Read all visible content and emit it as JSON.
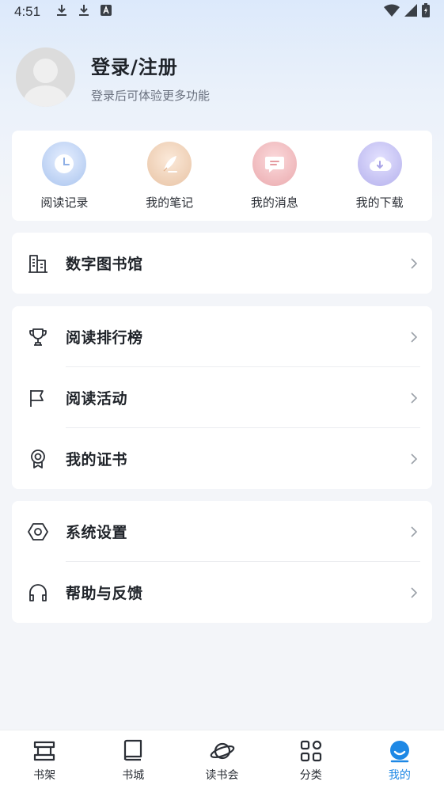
{
  "status_bar": {
    "time": "4:51",
    "left_icons": [
      "download-icon",
      "download-icon",
      "text-a-icon"
    ],
    "right_icons": [
      "wifi-icon",
      "cellular-signal-icon",
      "battery-icon"
    ]
  },
  "profile": {
    "title": "登录/注册",
    "subtitle": "登录后可体验更多功能"
  },
  "quick_actions": [
    {
      "label": "阅读记录",
      "icon": "clock-icon",
      "color": "#a9c4ee"
    },
    {
      "label": "我的笔记",
      "icon": "feather-icon",
      "color": "#e8c3a4"
    },
    {
      "label": "我的消息",
      "icon": "message-icon",
      "color": "#eaa9ad"
    },
    {
      "label": "我的下载",
      "icon": "cloud-download-icon",
      "color": "#b4b0ec"
    }
  ],
  "menu": {
    "library": {
      "label": "数字图书馆"
    },
    "ranking": {
      "label": "阅读排行榜"
    },
    "activity": {
      "label": "阅读活动"
    },
    "certificate": {
      "label": "我的证书"
    },
    "settings": {
      "label": "系统设置"
    },
    "help": {
      "label": "帮助与反馈"
    }
  },
  "bottom_nav": [
    {
      "label": "书架",
      "icon": "bookshelf-icon"
    },
    {
      "label": "书城",
      "icon": "book-icon"
    },
    {
      "label": "读书会",
      "icon": "planet-icon"
    },
    {
      "label": "分类",
      "icon": "grid-icon"
    },
    {
      "label": "我的",
      "icon": "profile-icon",
      "active": true
    }
  ],
  "colors": {
    "accent": "#1e88e5",
    "background": "#f3f5f9"
  }
}
